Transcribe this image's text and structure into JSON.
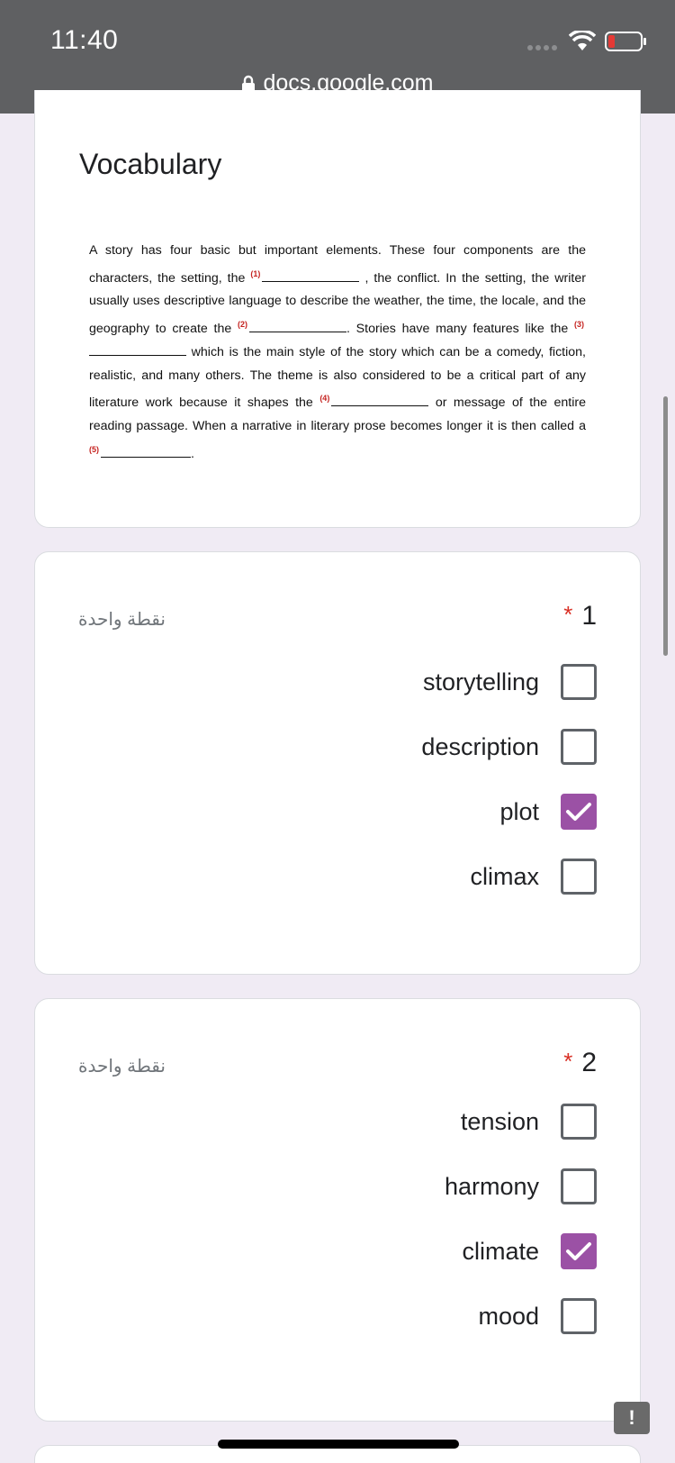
{
  "status_bar": {
    "time": "11:40"
  },
  "browser": {
    "url": "docs.google.com"
  },
  "vocab": {
    "title": "Vocabulary",
    "passage": {
      "p1": "A story has four basic but important elements. These four components are the characters, the setting, the",
      "m1": "(1)",
      "p2": ", the conflict. In the setting, the writer usually uses descriptive language to describe the weather, the time, the locale, and the geography to create the",
      "m2": "(2)",
      "p3": ". Stories have many features like the",
      "m3": "(3)",
      "p4": "which is the main style of the story which can be a comedy, fiction, realistic, and many others. The theme is also considered to be a critical part of any literature work because it shapes the",
      "m4": "(4)",
      "p5": "or message of the entire reading passage. When a narrative in literary prose becomes longer it is then called a",
      "m5": "(5)",
      "p6": "."
    }
  },
  "questions": [
    {
      "number": "1",
      "required_mark": "*",
      "points": "نقطة واحدة",
      "options": [
        {
          "label": "storytelling",
          "checked": false
        },
        {
          "label": "description",
          "checked": false
        },
        {
          "label": "plot",
          "checked": true
        },
        {
          "label": "climax",
          "checked": false
        }
      ]
    },
    {
      "number": "2",
      "required_mark": "*",
      "points": "نقطة واحدة",
      "options": [
        {
          "label": "tension",
          "checked": false
        },
        {
          "label": "harmony",
          "checked": false
        },
        {
          "label": "climate",
          "checked": true
        },
        {
          "label": "mood",
          "checked": false
        }
      ]
    }
  ],
  "feedback_button": {
    "label": "!"
  },
  "colors": {
    "accent": "#9b51a5",
    "required": "#d93025",
    "background": "#f0ebf4"
  }
}
